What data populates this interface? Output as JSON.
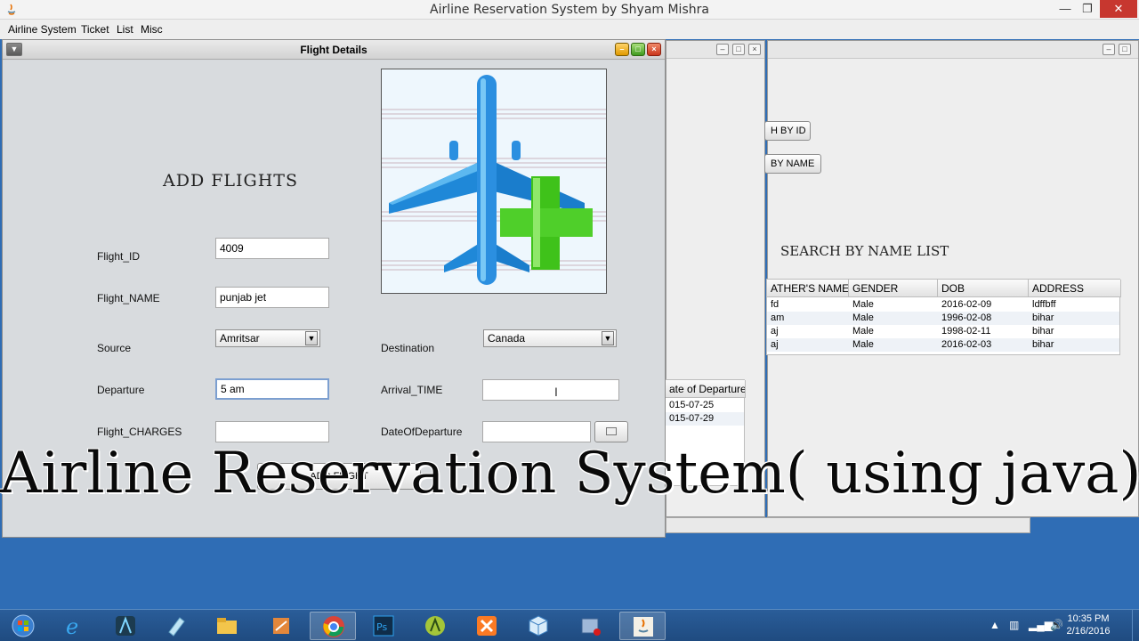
{
  "window": {
    "title": "Airline Reservation System by Shyam Mishra",
    "controls": {
      "minimize": "—",
      "restore": "❐",
      "close": "✕"
    }
  },
  "menubar": [
    "Airline System",
    "Ticket",
    "List",
    "Misc"
  ],
  "back_frames": {
    "search_buttons": [
      "H BY ID",
      "BY NAME"
    ],
    "search_heading": "SEARCH BY NAME LIST",
    "table": {
      "columns": [
        "ATHER'S NAME",
        "GENDER",
        "DOB",
        "ADDRESS"
      ],
      "rows": [
        [
          "fd",
          "Male",
          "2016-02-09",
          "ldffbff"
        ],
        [
          "am",
          "Male",
          "1996-02-08",
          "bihar"
        ],
        [
          "aj",
          "Male",
          "1998-02-11",
          "bihar"
        ],
        [
          "aj",
          "Male",
          "2016-02-03",
          "bihar"
        ]
      ]
    },
    "departure_table": {
      "column": "ate of Departure",
      "rows": [
        "015-07-25",
        "015-07-29"
      ]
    }
  },
  "flight_frame": {
    "title": "Flight Details",
    "heading": "ADD FLIGHTS",
    "fields": {
      "flight_id_label": "Flight_ID",
      "flight_id_value": "4009",
      "flight_name_label": "Flight_NAME",
      "flight_name_value": "punjab jet",
      "source_label": "Source",
      "source_value": "Amritsar",
      "destination_label": "Destination",
      "destination_value": "Canada",
      "departure_label": "Departure",
      "departure_value": "5 am",
      "arrival_label": "Arrival_TIME",
      "arrival_value": "",
      "charges_label": "Flight_CHARGES",
      "charges_value": "",
      "date_label": "DateOfDeparture",
      "date_value": ""
    },
    "add_button": "ADD FLIGHT",
    "image_icon": "airplane-add-icon"
  },
  "caption": "Airline Reservation System( using java)",
  "taskbar": {
    "icons": [
      "windows-start-icon",
      "internet-explorer-icon",
      "android-studio-icon",
      "notes-icon",
      "file-explorer-icon",
      "xampp-icon",
      "chrome-icon",
      "photoshop-icon",
      "android-icon",
      "apps-icon",
      "virtualbox-icon",
      "media-icon",
      "java-icon"
    ],
    "time": "10:35 PM",
    "date": "2/16/2016"
  },
  "colors": {
    "desktop": "#2f6db5",
    "taskbar": "#1f4b80",
    "close_red": "#c7372f",
    "frame_body": "#d8dbde",
    "plane_blue": "#2b8fe0",
    "plus_green": "#4fcf2a"
  }
}
